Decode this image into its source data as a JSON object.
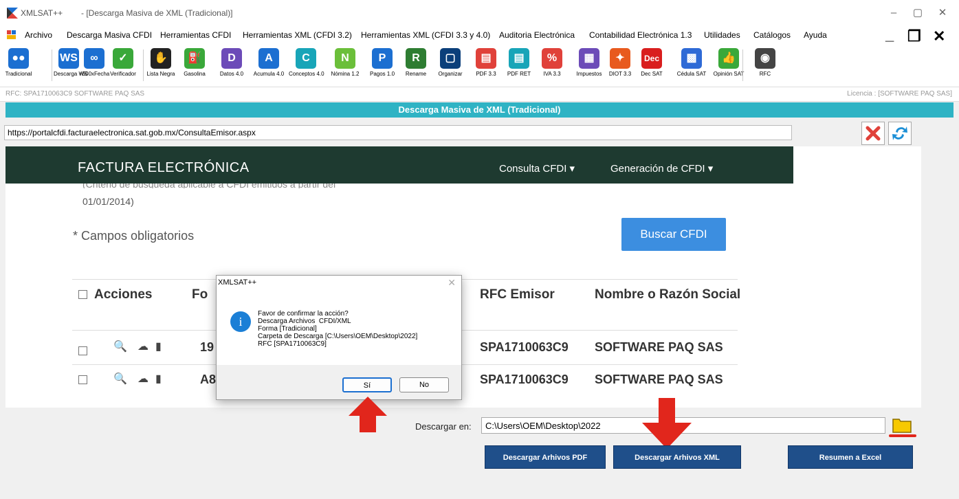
{
  "window": {
    "app_name": "XMLSAT++",
    "document_title": "- [Descarga Masiva de XML (Tradicional)]"
  },
  "menu": [
    "Archivo",
    "Descarga Masiva CFDI",
    "Herramientas CFDI",
    "Herramientas XML (CFDI 3.2)",
    "Herramientas XML (CFDI 3.3 y 4.0)",
    "Auditoria Electrónica",
    "Contabilidad Electrónica 1.3",
    "Utilidades",
    "Catálogos",
    "Ayuda"
  ],
  "toolbar": [
    {
      "label": "Tradicional",
      "color": "#1c6fd1",
      "glyph": "●●"
    },
    {
      "label": "Descarga WS",
      "color": "#1c6fd1",
      "glyph": "WS"
    },
    {
      "label": "+500xFecha",
      "color": "#1c6fd1",
      "glyph": "∞"
    },
    {
      "label": "Verificador",
      "color": "#3aa83a",
      "glyph": "✓"
    },
    {
      "label": "Lista Negra",
      "color": "#222222",
      "glyph": "✋"
    },
    {
      "label": "Gasolina",
      "color": "#3aa83a",
      "glyph": "⛽"
    },
    {
      "label": "Datos 4.0",
      "color": "#6c4bb8",
      "glyph": "D"
    },
    {
      "label": "Acumula 4.0",
      "color": "#1c6fd1",
      "glyph": "A"
    },
    {
      "label": "Conceptos 4.0",
      "color": "#18a5b8",
      "glyph": "C"
    },
    {
      "label": "Nómina 1.2",
      "color": "#6bbf3a",
      "glyph": "N"
    },
    {
      "label": "Pagos 1.0",
      "color": "#1c6fd1",
      "glyph": "P"
    },
    {
      "label": "Rename",
      "color": "#2e7d32",
      "glyph": "R"
    },
    {
      "label": "Organizar",
      "color": "#0b3f7a",
      "glyph": "▢"
    },
    {
      "label": "PDF 3.3",
      "color": "#e0413a",
      "glyph": "▤"
    },
    {
      "label": "PDF RET",
      "color": "#18a5b8",
      "glyph": "▤"
    },
    {
      "label": "IVA 3.3",
      "color": "#e0413a",
      "glyph": "%"
    },
    {
      "label": "Impuestos",
      "color": "#6c4bb8",
      "glyph": "▦"
    },
    {
      "label": "DIOT 3.3",
      "color": "#e85a1e",
      "glyph": "✦"
    },
    {
      "label": "Dec SAT",
      "color": "#d91e1e",
      "glyph": "Dec"
    },
    {
      "label": "Cédula SAT",
      "color": "#2e6ad6",
      "glyph": "▩"
    },
    {
      "label": "Opinión SAT",
      "color": "#3aa83a",
      "glyph": "👍"
    },
    {
      "label": "RFC",
      "color": "#444444",
      "glyph": "◉"
    }
  ],
  "rfc_bar": {
    "rfc": "RFC: SPA1710063C9 SOFTWARE PAQ SAS",
    "license": "Licencia : [SOFTWARE PAQ SAS]"
  },
  "header_band": "Descarga Masiva de XML (Tradicional)",
  "url": "https://portalcfdi.facturaelectronica.sat.gob.mx/ConsultaEmisor.aspx",
  "web": {
    "brand": "FACTURA ELECTRÓNICA",
    "nav_consulta": "Consulta CFDI ▾",
    "nav_generacion": "Generación de CFDI ▾",
    "criteria_partial": "(Criterio de búsqueda aplicable a CFDI emitidos a partir del",
    "criteria_date": "01/01/2014)",
    "required_note": "* Campos obligatorios",
    "search_button": "Buscar CFDI",
    "columns": {
      "actions": "Acciones",
      "fo": "Fo",
      "rfc": "RFC Emisor",
      "name": "Nombre o Razón Social"
    },
    "rows": [
      {
        "folio": "19",
        "rfc": "SPA1710063C9",
        "name": "SOFTWARE PAQ SAS"
      },
      {
        "folio": "A8",
        "rfc": "SPA1710063C9",
        "name": "SOFTWARE PAQ SAS"
      }
    ]
  },
  "dialog": {
    "title": "XMLSAT++",
    "message": "Favor de confirmar la acción?\nDescarga Archivos  CFDI/XML\nForma [Tradicional]\nCarpeta de Descarga [C:\\Users\\OEM\\Desktop\\2022]\nRFC [SPA1710063C9]",
    "yes": "Sí",
    "no": "No"
  },
  "download": {
    "label": "Descargar en:",
    "path": "C:\\Users\\OEM\\Desktop\\2022",
    "btn_pdf": "Descargar Arhivos PDF",
    "btn_xml": "Descargar Arhivos XML",
    "btn_excel": "Resumen a Excel"
  },
  "colors": {
    "accent_band": "#2fb3c4",
    "arrow_red": "#e1261c",
    "button_blue": "#1f4f8a"
  }
}
